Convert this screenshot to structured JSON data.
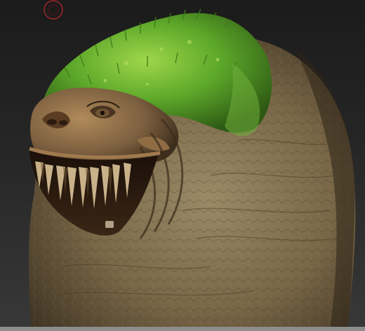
{
  "canvas": {
    "background_top": "#1b1b1b",
    "background_bottom": "#383838"
  },
  "model": {
    "body_color": "#7a6a4c",
    "skin_shadow_color": "#3a2e1e",
    "moss_color": "#5da82a",
    "moss_highlight_color": "#9fd64a",
    "mouth_color": "#2a1a10",
    "tooth_color": "#c9b28a"
  },
  "cursor": {
    "icon": "brush-cursor-icon",
    "color": "#c0262c"
  }
}
